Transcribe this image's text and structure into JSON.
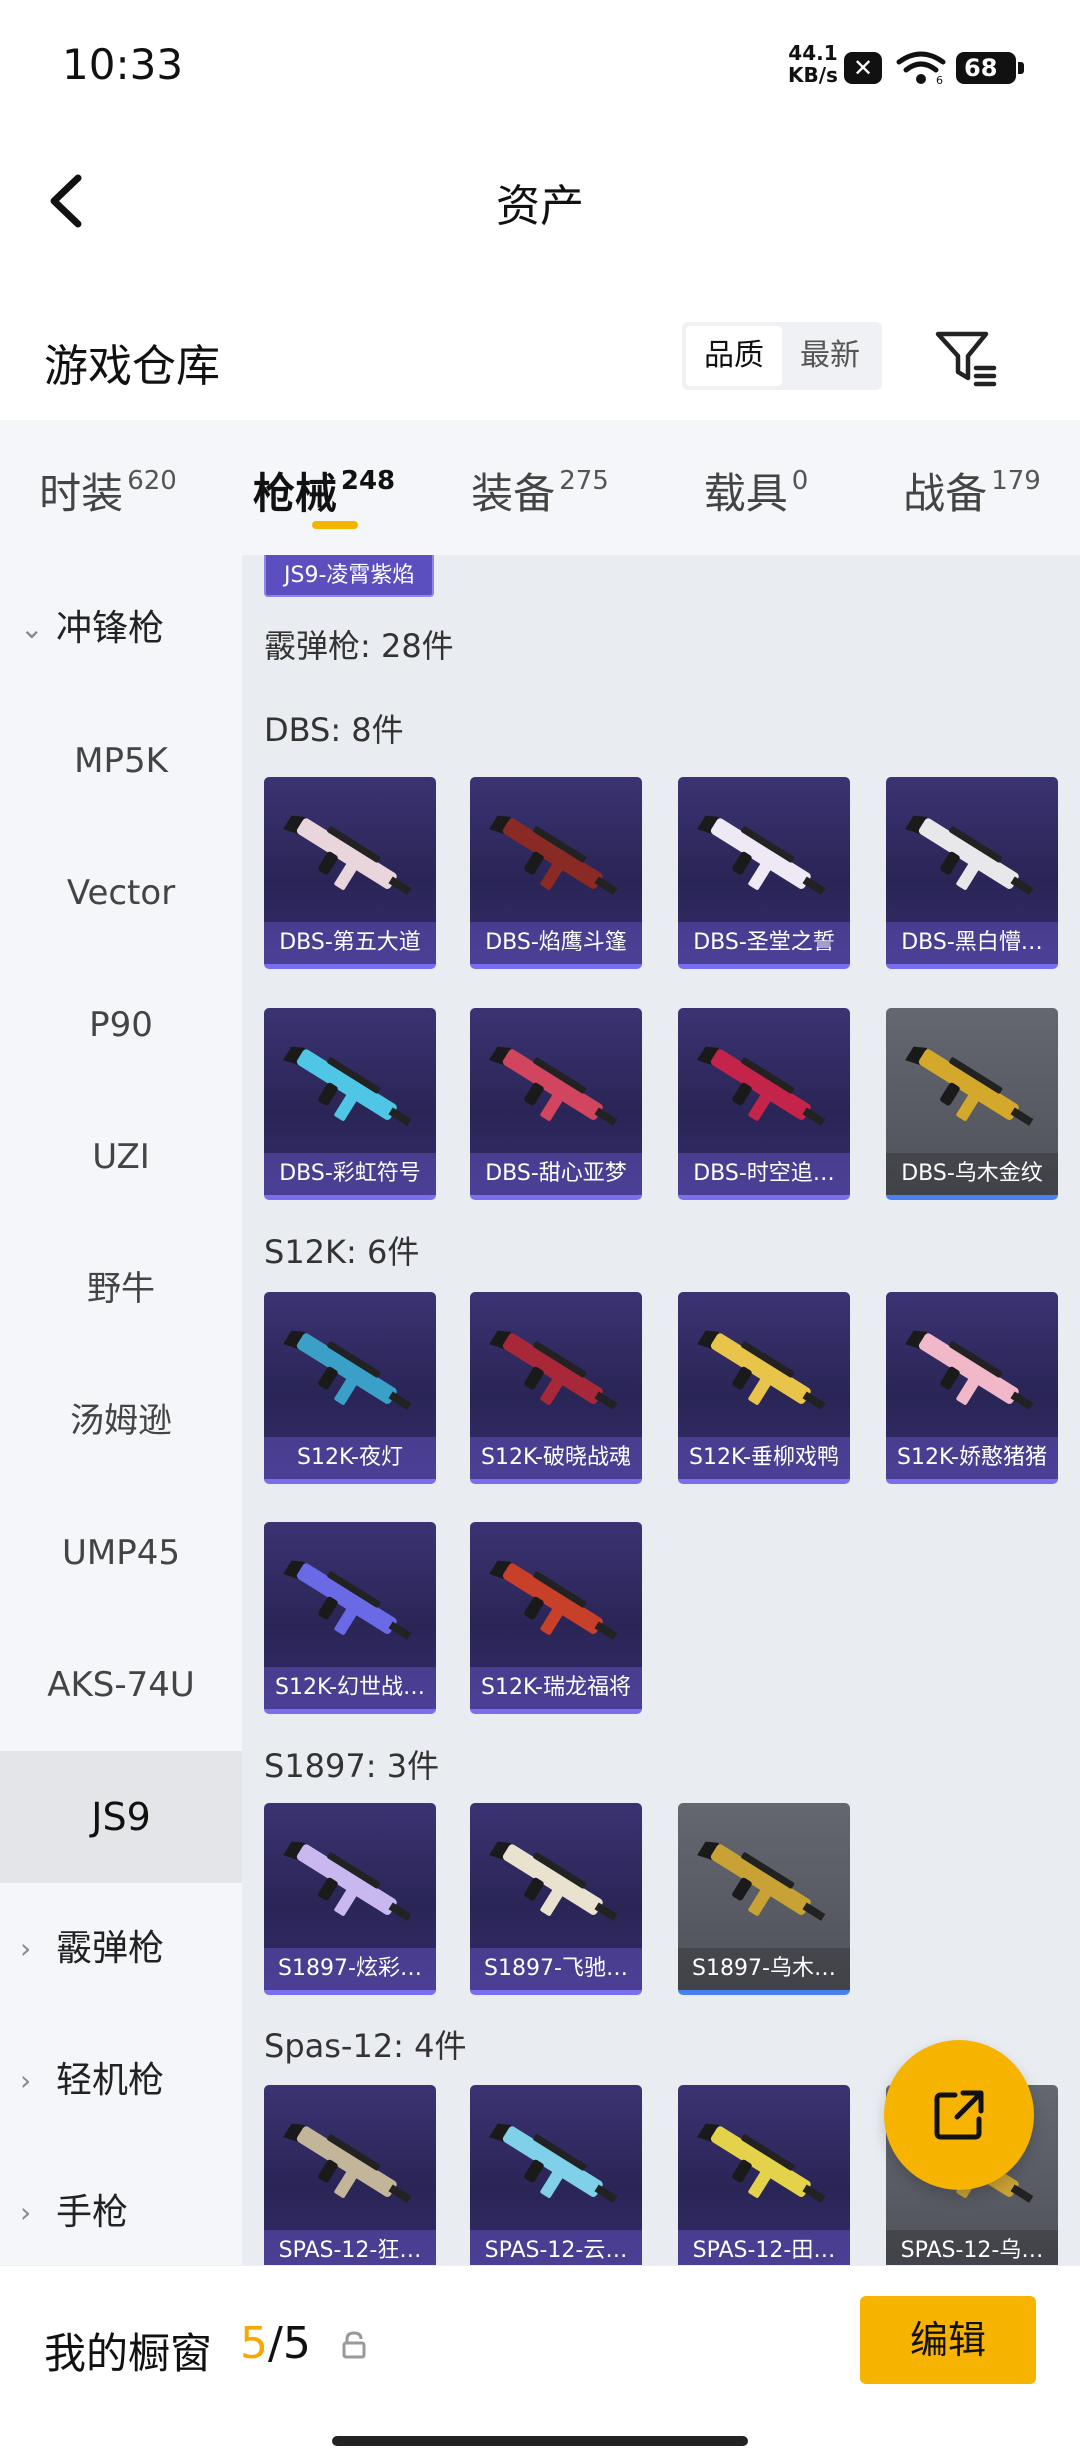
{
  "status": {
    "time": "10:33",
    "net_speed_value": "44.1",
    "net_speed_unit": "KB/s",
    "battery": "68",
    "wifi_label": "6"
  },
  "appbar": {
    "title": "资产"
  },
  "warehouse": {
    "title": "游戏仓库",
    "sort_options": [
      "品质",
      "最新"
    ],
    "sort_selected": "品质"
  },
  "tabs": [
    {
      "label": "时装",
      "count": "620"
    },
    {
      "label": "枪械",
      "count": "248",
      "active": true
    },
    {
      "label": "装备",
      "count": "275"
    },
    {
      "label": "载具",
      "count": "0"
    },
    {
      "label": "战备",
      "count": "179"
    }
  ],
  "sidebar": {
    "items": [
      {
        "label": "冲锋枪",
        "type": "group",
        "expanded": true
      },
      {
        "label": "MP5K"
      },
      {
        "label": "Vector"
      },
      {
        "label": "P90"
      },
      {
        "label": "UZI"
      },
      {
        "label": "野牛"
      },
      {
        "label": "汤姆逊"
      },
      {
        "label": "UMP45"
      },
      {
        "label": "AKS-74U"
      },
      {
        "label": "JS9",
        "active": true
      },
      {
        "label": "霰弹枪",
        "type": "group"
      },
      {
        "label": "轻机枪",
        "type": "group"
      },
      {
        "label": "手枪",
        "type": "group"
      }
    ]
  },
  "content": {
    "top_chip": "JS9-凌霄紫焰",
    "category_heading": "霰弹枪: 28件",
    "sections": [
      {
        "heading": "DBS: 8件",
        "items": [
          {
            "name": "DBS-第五大道",
            "tone": "purple",
            "gun": "#e9d6dc"
          },
          {
            "name": "DBS-焰鹰斗篷",
            "tone": "purple",
            "gun": "#8a2a24"
          },
          {
            "name": "DBS-圣堂之誓",
            "tone": "purple",
            "gun": "#efe8f5"
          },
          {
            "name": "DBS-黑白懵…",
            "tone": "purple",
            "gun": "#e8e8ea"
          },
          {
            "name": "DBS-彩虹符号",
            "tone": "purple",
            "gun": "#4fc6e6"
          },
          {
            "name": "DBS-甜心亚梦",
            "tone": "purple",
            "gun": "#d2455e"
          },
          {
            "name": "DBS-时空追…",
            "tone": "purple",
            "gun": "#c4244a"
          },
          {
            "name": "DBS-乌木金纹",
            "tone": "gray",
            "gun": "#d4a82a"
          }
        ]
      },
      {
        "heading": "S12K: 6件",
        "items": [
          {
            "name": "S12K-夜灯",
            "tone": "purple",
            "gun": "#3aa0c8"
          },
          {
            "name": "S12K-破晓战魂",
            "tone": "purple",
            "gun": "#a8283a"
          },
          {
            "name": "S12K-垂柳戏鸭",
            "tone": "purple",
            "gun": "#e9c44a"
          },
          {
            "name": "S12K-娇憨猪猪",
            "tone": "purple",
            "gun": "#f0b8c8"
          },
          {
            "name": "S12K-幻世战…",
            "tone": "purple",
            "gun": "#6a6ae6"
          },
          {
            "name": "S12K-瑞龙福将",
            "tone": "purple",
            "gun": "#c8402a"
          }
        ]
      },
      {
        "heading": "S1897: 3件",
        "items": [
          {
            "name": "S1897-炫彩…",
            "tone": "purple",
            "gun": "#c9b8f0"
          },
          {
            "name": "S1897-飞驰…",
            "tone": "purple",
            "gun": "#e8e2cf"
          },
          {
            "name": "S1897-乌木…",
            "tone": "gray",
            "gun": "#c9a235"
          }
        ]
      },
      {
        "heading": "Spas-12: 4件",
        "items": [
          {
            "name": "SPAS-12-狂…",
            "tone": "purple",
            "gun": "#c2b59a"
          },
          {
            "name": "SPAS-12-云…",
            "tone": "purple",
            "gun": "#7fd0e8"
          },
          {
            "name": "SPAS-12-田…",
            "tone": "purple",
            "gun": "#e4d24a"
          },
          {
            "name": "SPAS-12-乌…",
            "tone": "gray",
            "gun": "#c9a235"
          }
        ]
      }
    ]
  },
  "bottom": {
    "label": "我的橱窗",
    "count_current": "5",
    "count_sep": "/",
    "count_total": "5",
    "edit_label": "编辑"
  },
  "colors": {
    "accent": "#f6b300",
    "card_purple": "#2d2760",
    "card_gray": "#5b5e66"
  }
}
